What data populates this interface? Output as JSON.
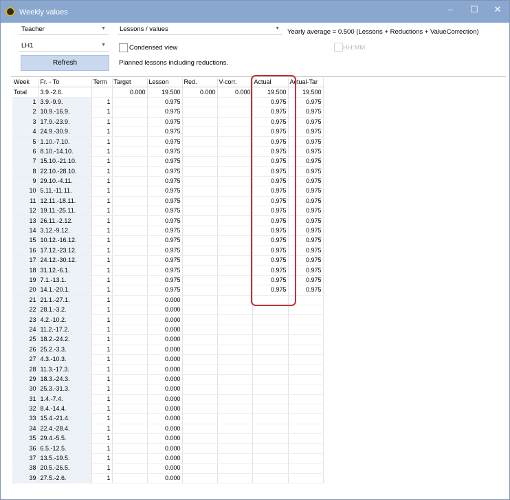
{
  "window": {
    "title": "Weekly values",
    "controls": {
      "minimize": "‒",
      "maximize": "☐",
      "close": "✕"
    }
  },
  "toolbar": {
    "element_type": "Teacher",
    "view_type": "Lessons / values",
    "element": "LH1",
    "refresh_label": "Refresh",
    "condensed_label": "Condensed view",
    "note": "Planned lessons including reductions.",
    "yearly_average": "Yearly average = 0.500 (Lessons + Reductions + ValueCorrection)",
    "hhmm_label": "HH:MM"
  },
  "grid": {
    "columns": [
      "Week",
      "Fr. - To",
      "Term",
      "Target",
      "Lesson",
      "Red.",
      "V-corr.",
      "Actual",
      "Actual-Tar"
    ],
    "total": {
      "label": "Total",
      "range": "3.9.-2.6.",
      "term": "",
      "target": "0.000",
      "lesson": "19.500",
      "red": "0.000",
      "vcorr": "0.000",
      "actual": "19.500",
      "diff": "19.500"
    },
    "rows": [
      {
        "week": "1",
        "range": "3.9.-9.9.",
        "term": "1",
        "lesson": "0.975",
        "actual": "0.975",
        "diff": "0.975"
      },
      {
        "week": "2",
        "range": "10.9.-16.9.",
        "term": "1",
        "lesson": "0.975",
        "actual": "0.975",
        "diff": "0.975"
      },
      {
        "week": "3",
        "range": "17.9.-23.9.",
        "term": "1",
        "lesson": "0.975",
        "actual": "0.975",
        "diff": "0.975"
      },
      {
        "week": "4",
        "range": "24.9.-30.9.",
        "term": "1",
        "lesson": "0.975",
        "actual": "0.975",
        "diff": "0.975"
      },
      {
        "week": "5",
        "range": "1.10.-7.10.",
        "term": "1",
        "lesson": "0.975",
        "actual": "0.975",
        "diff": "0.975"
      },
      {
        "week": "6",
        "range": "8.10.-14.10.",
        "term": "1",
        "lesson": "0.975",
        "actual": "0.975",
        "diff": "0.975"
      },
      {
        "week": "7",
        "range": "15.10.-21.10.",
        "term": "1",
        "lesson": "0.975",
        "actual": "0.975",
        "diff": "0.975"
      },
      {
        "week": "8",
        "range": "22.10.-28.10.",
        "term": "1",
        "lesson": "0.975",
        "actual": "0.975",
        "diff": "0.975"
      },
      {
        "week": "9",
        "range": "29.10.-4.11.",
        "term": "1",
        "lesson": "0.975",
        "actual": "0.975",
        "diff": "0.975"
      },
      {
        "week": "10",
        "range": "5.11.-11.11.",
        "term": "1",
        "lesson": "0.975",
        "actual": "0.975",
        "diff": "0.975"
      },
      {
        "week": "11",
        "range": "12.11.-18.11.",
        "term": "1",
        "lesson": "0.975",
        "actual": "0.975",
        "diff": "0.975"
      },
      {
        "week": "12",
        "range": "19.11.-25.11.",
        "term": "1",
        "lesson": "0.975",
        "actual": "0.975",
        "diff": "0.975"
      },
      {
        "week": "13",
        "range": "26.11.-2.12.",
        "term": "1",
        "lesson": "0.975",
        "actual": "0.975",
        "diff": "0.975"
      },
      {
        "week": "14",
        "range": "3.12.-9.12.",
        "term": "1",
        "lesson": "0.975",
        "actual": "0.975",
        "diff": "0.975"
      },
      {
        "week": "15",
        "range": "10.12.-16.12.",
        "term": "1",
        "lesson": "0.975",
        "actual": "0.975",
        "diff": "0.975"
      },
      {
        "week": "16",
        "range": "17.12.-23.12.",
        "term": "1",
        "lesson": "0.975",
        "actual": "0.975",
        "diff": "0.975"
      },
      {
        "week": "17",
        "range": "24.12.-30.12.",
        "term": "1",
        "lesson": "0.975",
        "actual": "0.975",
        "diff": "0.975"
      },
      {
        "week": "18",
        "range": "31.12.-6.1.",
        "term": "1",
        "lesson": "0.975",
        "actual": "0.975",
        "diff": "0.975"
      },
      {
        "week": "19",
        "range": "7.1.-13.1.",
        "term": "1",
        "lesson": "0.975",
        "actual": "0.975",
        "diff": "0.975"
      },
      {
        "week": "20",
        "range": "14.1.-20.1.",
        "term": "1",
        "lesson": "0.975",
        "actual": "0.975",
        "diff": "0.975"
      },
      {
        "week": "21",
        "range": "21.1.-27.1.",
        "term": "1",
        "lesson": "0.000",
        "actual": "",
        "diff": ""
      },
      {
        "week": "22",
        "range": "28.1.-3.2.",
        "term": "1",
        "lesson": "0.000",
        "actual": "",
        "diff": ""
      },
      {
        "week": "23",
        "range": "4.2.-10.2.",
        "term": "1",
        "lesson": "0.000",
        "actual": "",
        "diff": ""
      },
      {
        "week": "24",
        "range": "11.2.-17.2.",
        "term": "1",
        "lesson": "0.000",
        "actual": "",
        "diff": ""
      },
      {
        "week": "25",
        "range": "18.2.-24.2.",
        "term": "1",
        "lesson": "0.000",
        "actual": "",
        "diff": ""
      },
      {
        "week": "26",
        "range": "25.2.-3.3.",
        "term": "1",
        "lesson": "0.000",
        "actual": "",
        "diff": ""
      },
      {
        "week": "27",
        "range": "4.3.-10.3.",
        "term": "1",
        "lesson": "0.000",
        "actual": "",
        "diff": ""
      },
      {
        "week": "28",
        "range": "11.3.-17.3.",
        "term": "1",
        "lesson": "0.000",
        "actual": "",
        "diff": ""
      },
      {
        "week": "29",
        "range": "18.3.-24.3.",
        "term": "1",
        "lesson": "0.000",
        "actual": "",
        "diff": ""
      },
      {
        "week": "30",
        "range": "25.3.-31.3.",
        "term": "1",
        "lesson": "0.000",
        "actual": "",
        "diff": ""
      },
      {
        "week": "31",
        "range": "1.4.-7.4.",
        "term": "1",
        "lesson": "0.000",
        "actual": "",
        "diff": ""
      },
      {
        "week": "32",
        "range": "8.4.-14.4.",
        "term": "1",
        "lesson": "0.000",
        "actual": "",
        "diff": ""
      },
      {
        "week": "33",
        "range": "15.4.-21.4.",
        "term": "1",
        "lesson": "0.000",
        "actual": "",
        "diff": ""
      },
      {
        "week": "34",
        "range": "22.4.-28.4.",
        "term": "1",
        "lesson": "0.000",
        "actual": "",
        "diff": ""
      },
      {
        "week": "35",
        "range": "29.4.-5.5.",
        "term": "1",
        "lesson": "0.000",
        "actual": "",
        "diff": ""
      },
      {
        "week": "36",
        "range": "6.5.-12.5.",
        "term": "1",
        "lesson": "0.000",
        "actual": "",
        "diff": ""
      },
      {
        "week": "37",
        "range": "13.5.-19.5.",
        "term": "1",
        "lesson": "0.000",
        "actual": "",
        "diff": ""
      },
      {
        "week": "38",
        "range": "20.5.-26.5.",
        "term": "1",
        "lesson": "0.000",
        "actual": "",
        "diff": ""
      },
      {
        "week": "39",
        "range": "27.5.-2.6.",
        "term": "1",
        "lesson": "0.000",
        "actual": "",
        "diff": ""
      }
    ]
  },
  "colors": {
    "titlebar": "#8aa7cf",
    "refresh_button": "#c9d8ef",
    "term_header": "#f6e2c8",
    "week_column": "#edf1f8",
    "highlight_frame": "#c1323a"
  }
}
